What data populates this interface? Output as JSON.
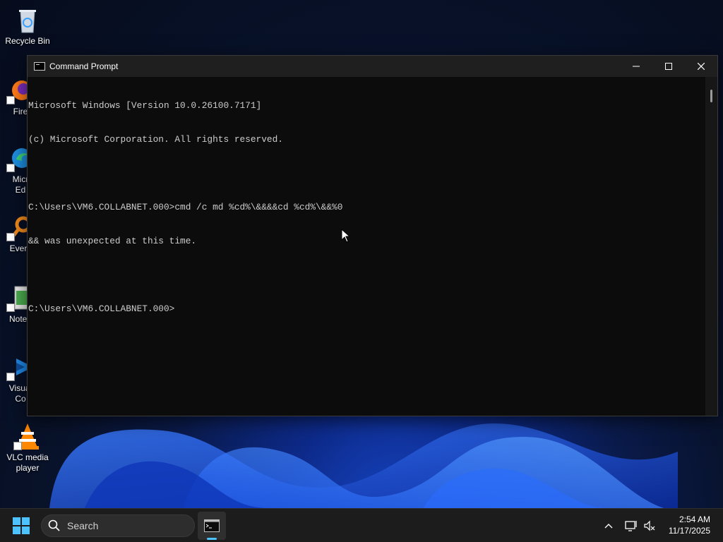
{
  "desktop": {
    "icons": [
      {
        "label": "Recycle Bin"
      },
      {
        "label": "Fire"
      },
      {
        "label": "Micr\nEd"
      },
      {
        "label": "Every"
      },
      {
        "label": "Notep"
      },
      {
        "label": "Visual\nCo"
      },
      {
        "label": "VLC media\nplayer"
      }
    ]
  },
  "window": {
    "title": "Command Prompt",
    "console_lines": [
      "Microsoft Windows [Version 10.0.26100.7171]",
      "(c) Microsoft Corporation. All rights reserved.",
      "",
      "C:\\Users\\VM6.COLLABNET.000>cmd /c md %cd%\\&&&&cd %cd%\\&&%0",
      "&& was unexpected at this time.",
      "",
      "C:\\Users\\VM6.COLLABNET.000>"
    ]
  },
  "taskbar": {
    "search_placeholder": "Search",
    "clock_time": "2:54 AM",
    "clock_date": "11/17/2025"
  },
  "colors": {
    "console_bg": "#0c0c0c",
    "console_text": "#cccccc",
    "accent": "#4cc2ff"
  }
}
